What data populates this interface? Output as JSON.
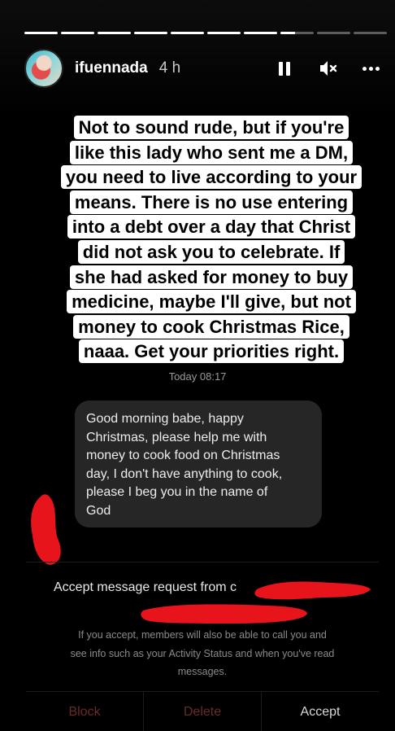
{
  "story": {
    "progress": {
      "segments_total": 10,
      "segments_complete": 7,
      "current_segment_progress": 0.45
    },
    "header": {
      "username": "ifuennada",
      "time_ago": "4 h",
      "icons": [
        "pause-icon",
        "mute-icon",
        "more-icon"
      ]
    },
    "caption": {
      "lines": [
        "Not to sound rude, but if you're",
        "like this lady who sent me a DM,",
        "you need to live according to your",
        "means. There is no use entering",
        "into a debt over a day that Christ",
        "did not ask you to celebrate. If",
        "she had asked for money to buy",
        "medicine, maybe I'll give, but not",
        "money to cook Christmas Rice,",
        "naaa. Get your priorities right."
      ]
    }
  },
  "screenshot": {
    "timestamp": "Today 08:17",
    "message": {
      "lines": [
        "Good morning babe, happy",
        "Christmas, please help me with",
        "money to cook food on Christmas",
        "day, I don't have anything to cook,",
        "please I beg you in the name of",
        "God"
      ]
    },
    "request": {
      "title": "Accept message request from c",
      "info_lines": [
        "If you accept, members will also be able to call you and",
        "see info such as your Activity Status and when you've read",
        "messages."
      ],
      "buttons": {
        "block": "Block",
        "delete": "Delete",
        "accept": "Accept"
      }
    }
  },
  "colors": {
    "redaction": "#e8141b",
    "bubble": "#262626",
    "caption_bg": "#ffffff",
    "destructive": "#6b2a2a"
  }
}
